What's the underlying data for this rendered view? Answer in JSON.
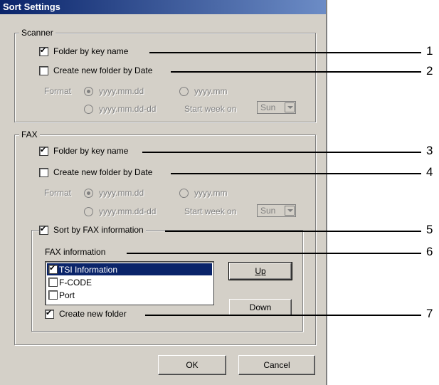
{
  "dialog": {
    "title": "Sort Settings"
  },
  "scanner": {
    "legend": "Scanner",
    "folder_by_key": "Folder by key name",
    "create_by_date": "Create new folder by Date",
    "format_label": "Format",
    "opt_ymd": "yyyy.mm.dd",
    "opt_ym": "yyyy.mm",
    "opt_ymd_dd": "yyyy.mm.dd-dd",
    "start_week_label": "Start week on",
    "start_week_value": "Sun"
  },
  "fax": {
    "legend": "FAX",
    "folder_by_key": "Folder by key name",
    "create_by_date": "Create new folder by Date",
    "format_label": "Format",
    "opt_ymd": "yyyy.mm.dd",
    "opt_ym": "yyyy.mm",
    "opt_ymd_dd": "yyyy.mm.dd-dd",
    "start_week_label": "Start week on",
    "start_week_value": "Sun",
    "sort_by_fax": "Sort by FAX information",
    "fax_info_label": "FAX information",
    "fax_info_items": [
      "TSI Information",
      "F-CODE",
      "Port"
    ],
    "up_label": "Up",
    "down_label": "Down",
    "create_new_folder": "Create new folder"
  },
  "buttons": {
    "ok": "OK",
    "cancel": "Cancel"
  },
  "callouts": [
    "1",
    "2",
    "3",
    "4",
    "5",
    "6",
    "7"
  ]
}
